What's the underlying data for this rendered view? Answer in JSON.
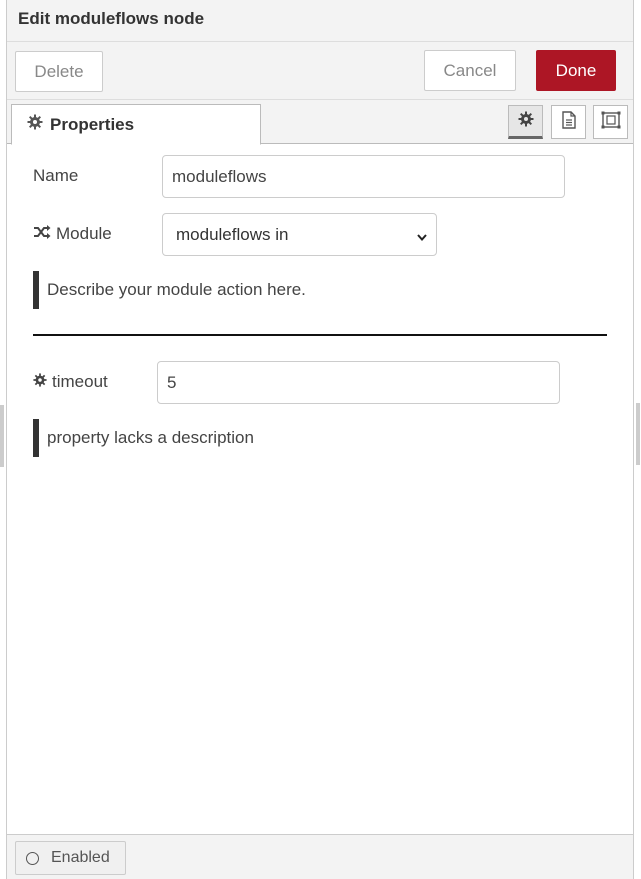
{
  "header": {
    "title": "Edit moduleflows node"
  },
  "toolbar": {
    "delete_label": "Delete",
    "cancel_label": "Cancel",
    "done_label": "Done"
  },
  "tabs": {
    "properties_label": "Properties"
  },
  "form": {
    "name_label": "Name",
    "name_value": "moduleflows",
    "module_label": "Module",
    "module_value": "moduleflows in",
    "module_description": "Describe your module action here.",
    "timeout_label": "timeout",
    "timeout_value": "5",
    "timeout_description": "property lacks a description"
  },
  "footer": {
    "enabled_label": "Enabled"
  },
  "colors": {
    "done_button": "#ad1625",
    "panel_bg": "#f3f3f3"
  }
}
